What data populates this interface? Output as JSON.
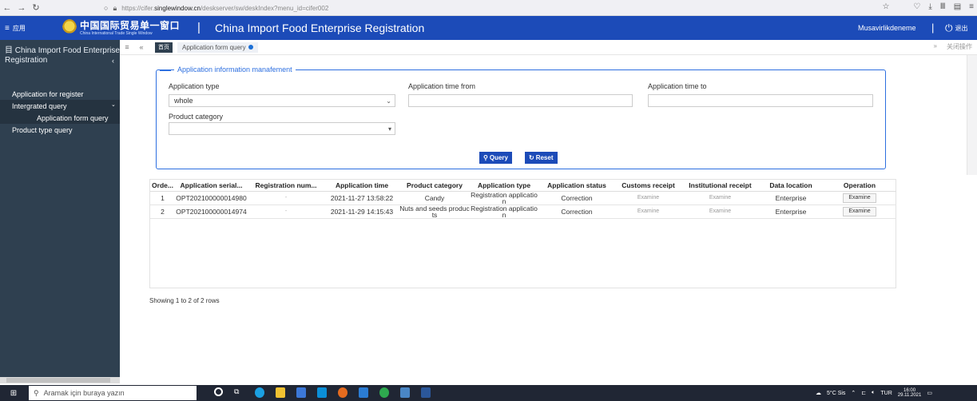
{
  "browser": {
    "url_prefix": "https://cifer.",
    "url_domain": "singlewindow.cn",
    "url_path": "/deskserver/sw/deskIndex?menu_id=cifer002"
  },
  "header": {
    "menu_label": "应用",
    "logo_cn": "中国国际贸易单一窗口",
    "logo_en": "China International Trade Single Window",
    "title": "China Import Food Enterprise Registration",
    "user": "Musavirlikdeneme",
    "logout_label": "退出"
  },
  "sidebar": {
    "title": "China Import Food Enterprise Registration",
    "items": [
      {
        "label": "Application for register"
      },
      {
        "label": "Intergrated query"
      },
      {
        "label": "Application form query"
      },
      {
        "label": "Product type query"
      }
    ]
  },
  "tabs": {
    "home": "首页",
    "active": "Application form query",
    "close_ops": "关闭操作"
  },
  "form": {
    "legend": "Application information manafement",
    "application_type_label": "Application type",
    "application_type_value": "whole",
    "time_from_label": "Application time from",
    "time_to_label": "Application time to",
    "product_category_label": "Product category",
    "query_button": "Query",
    "reset_button": "Reset"
  },
  "table": {
    "columns": [
      "Orde...",
      "Application serial...",
      "Registration num...",
      "Application time",
      "Product category",
      "Application type",
      "Application status",
      "Customs receipt",
      "Institutional receipt",
      "Data location",
      "Operation"
    ],
    "rows": [
      {
        "order": "1",
        "serial": "OPT202100000014980",
        "registration": "-",
        "time": "2021-11-27 13:58:22",
        "category": "Candy",
        "type": "Registration application",
        "status": "Correction",
        "customs": "Examine",
        "institutional": "Examine",
        "location": "Enterprise",
        "operation": "Examine"
      },
      {
        "order": "2",
        "serial": "OPT202100000014974",
        "registration": "-",
        "time": "2021-11-29 14:15:43",
        "category": "Nuts and seeds products",
        "type": "Registration application",
        "status": "Correction",
        "customs": "Examine",
        "institutional": "Examine",
        "location": "Enterprise",
        "operation": "Examine"
      }
    ],
    "showing": "Showing 1 to 2 of 2 rows"
  },
  "taskbar": {
    "search_placeholder": "Aramak için buraya yazın",
    "weather": "5°C Sis",
    "lang": "TUR",
    "time": "16:00",
    "date": "29.11.2021"
  },
  "colors": {
    "header_blue": "#1c4bb8",
    "sidebar": "#2f4050",
    "fieldset_border": "#2d6fe0"
  }
}
